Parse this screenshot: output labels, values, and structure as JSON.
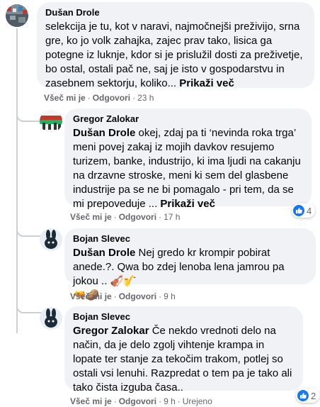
{
  "comments": [
    {
      "author": "Dušan Drole",
      "text": "selekcija je tu, kot v naravi, najmočnejši preživijo, srna gre, ko jo volk zahajka, zajec prav tako, lisica ga potegne iz luknje, kdor si je prislužil dosti za preživetje, bo ostal, ostali pač ne, saj je isto v gospodarstvu in zasebnem sektorju, koliko...",
      "see_more": "Prikaži več",
      "like": "Všeč mi je",
      "reply": "Odgovori",
      "time": "23 h"
    },
    {
      "author": "Gregor Zalokar",
      "mention": "Dušan Drole",
      "text": "okej, zdaj pa ti ‘nevinda roka trga’ meni povej zakaj iz mojih davkov resujemo turizem, banke, industrijo, ki ima ljudi na cakanju na drzavne stroske, meni ki sem del glasbene industrije pa se ne bi pomagalo - pri tem, da se mi prepoveduje ...",
      "see_more": "Prikaži več",
      "like": "Všeč mi je",
      "reply": "Odgovori",
      "time": "17 h",
      "reactions": "4"
    },
    {
      "author": "Bojan Slevec",
      "mention": "Dušan Drole",
      "text": "Nej gredo kr krompir pobirat anede.?. Qwa bo zdej lenoba lena jamrou pa jokou .. 🎻🎷",
      "emoji_line": "🔫🥔",
      "like": "Všeč mi je",
      "reply": "Odgovori",
      "time": "9 h"
    },
    {
      "author": "Bojan Slevec",
      "mention": "Gregor Zalokar",
      "text": "Če nekdo vrednoti delo na način, da je delo zgolj vihtenje krampa in lopate ter stanje za tekočim trakom, potlej so ostali vsi lenuhi. Razpredat o tem pa je tako ali tako čista izguba časa..",
      "like": "Všeč mi je",
      "reply": "Odgovori",
      "time": "9 h",
      "edited": "Urejeno",
      "reactions": "2"
    }
  ],
  "colors": {
    "bubble": "#f0f2f5",
    "meta": "#65676b",
    "like_blue": "#1877f2",
    "thread_line": "#ccd0d5"
  },
  "icons": [
    "like-icon",
    "avatar-flag-icon",
    "avatar-bunny-icon"
  ]
}
